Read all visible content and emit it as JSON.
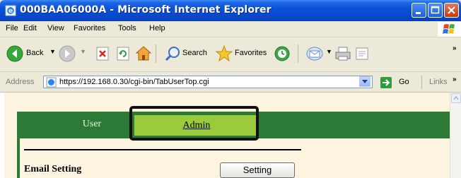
{
  "window": {
    "title": "000BAA06000A - Microsoft Internet Explorer"
  },
  "menu": {
    "items": [
      "File",
      "Edit",
      "View",
      "Favorites",
      "Tools",
      "Help"
    ]
  },
  "toolbar": {
    "back_label": "Back",
    "search_label": "Search",
    "favorites_label": "Favorites"
  },
  "address": {
    "label": "Address",
    "url": "https://192.168.0.30/cgi-bin/TabUserTop.cgi",
    "go_label": "Go",
    "links_label": "Links"
  },
  "page": {
    "tabs": [
      {
        "label": "User",
        "active": false
      },
      {
        "label": "Admin",
        "active": true
      }
    ],
    "email_label": "Email Setting",
    "setting_button": "Setting"
  },
  "colors": {
    "tab_bar": "#2d7a36",
    "active_tab": "#9acb3c",
    "page_bg": "#fdf5e0",
    "title_bar": "#0a52d9"
  },
  "icons": [
    "ie-page-icon",
    "minimize-icon",
    "maximize-icon",
    "close-icon",
    "windows-logo-icon",
    "back-icon",
    "forward-icon",
    "stop-icon",
    "refresh-icon",
    "home-icon",
    "search-icon",
    "favorites-star-icon",
    "history-icon",
    "mail-icon",
    "print-icon",
    "edit-icon",
    "go-arrow-icon"
  ]
}
